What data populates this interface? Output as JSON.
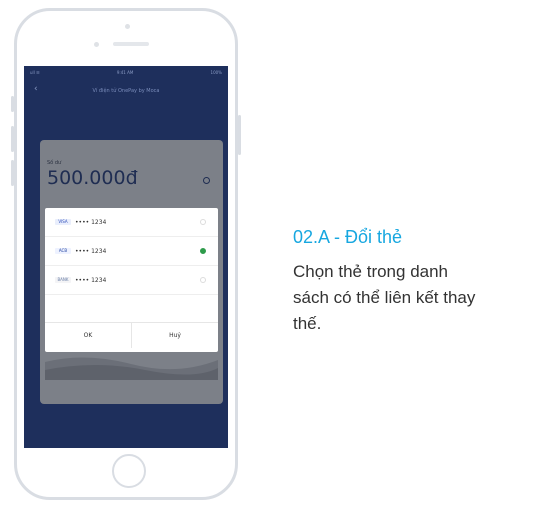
{
  "phone": {
    "status_left": "ull ☰",
    "status_center": "9:41 AM",
    "status_right": "100%",
    "nav_title": "Ví điện tử OnePay by Moca",
    "amount_caption": "Số dư",
    "amount": "500.000đ"
  },
  "modal": {
    "cards": [
      {
        "bank": "VISA",
        "number": "•••• 1234",
        "selected": false
      },
      {
        "bank": "ACB",
        "number": "•••• 1234",
        "selected": true
      },
      {
        "bank": "BANK",
        "number": "•••• 1234",
        "selected": false
      }
    ],
    "ok_label": "OK",
    "cancel_label": "Huỷ"
  },
  "step": {
    "title": "02.A - Đổi thẻ",
    "desc_lines": [
      "Chọn thẻ trong danh",
      "sách có thể liên kết thay",
      "thế."
    ]
  },
  "colors": {
    "accent": "#17a7e0",
    "screen_bg": "#1e2f5c",
    "selected_radio": "#2e9b4b"
  }
}
